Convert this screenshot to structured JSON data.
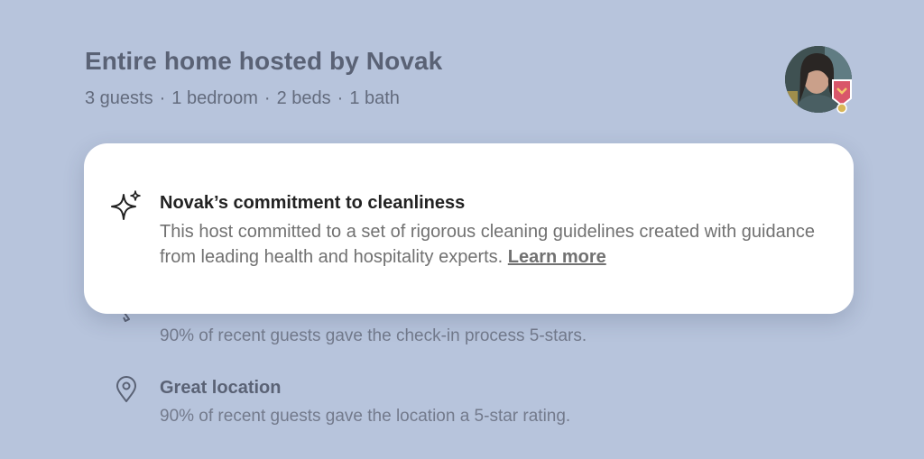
{
  "listing": {
    "title": "Entire home hosted by Novak",
    "details": [
      "3 guests",
      "1 bedroom",
      "2 beds",
      "1 bath"
    ],
    "separator": "·"
  },
  "host": {
    "avatar_icon": "host-avatar",
    "badge_icon": "superhost-badge-icon"
  },
  "cleanliness_card": {
    "icon": "sparkle-icon",
    "title": "Novak’s commitment to cleanliness",
    "body": "This host committed to a set of rigorous cleaning guidelines created with guidance from leading health and hospitality experts.",
    "learn_more": "Learn more"
  },
  "highlights": [
    {
      "icon": "key-icon",
      "title": "",
      "description": "90% of recent guests gave the check-in process 5-stars."
    },
    {
      "icon": "location-pin-icon",
      "title": "Great location",
      "description": "90% of recent guests gave the location a 5-star rating."
    }
  ],
  "colors": {
    "background": "#b7c4dc",
    "card": "#ffffff",
    "title_text": "#222222",
    "body_text": "#717171"
  }
}
